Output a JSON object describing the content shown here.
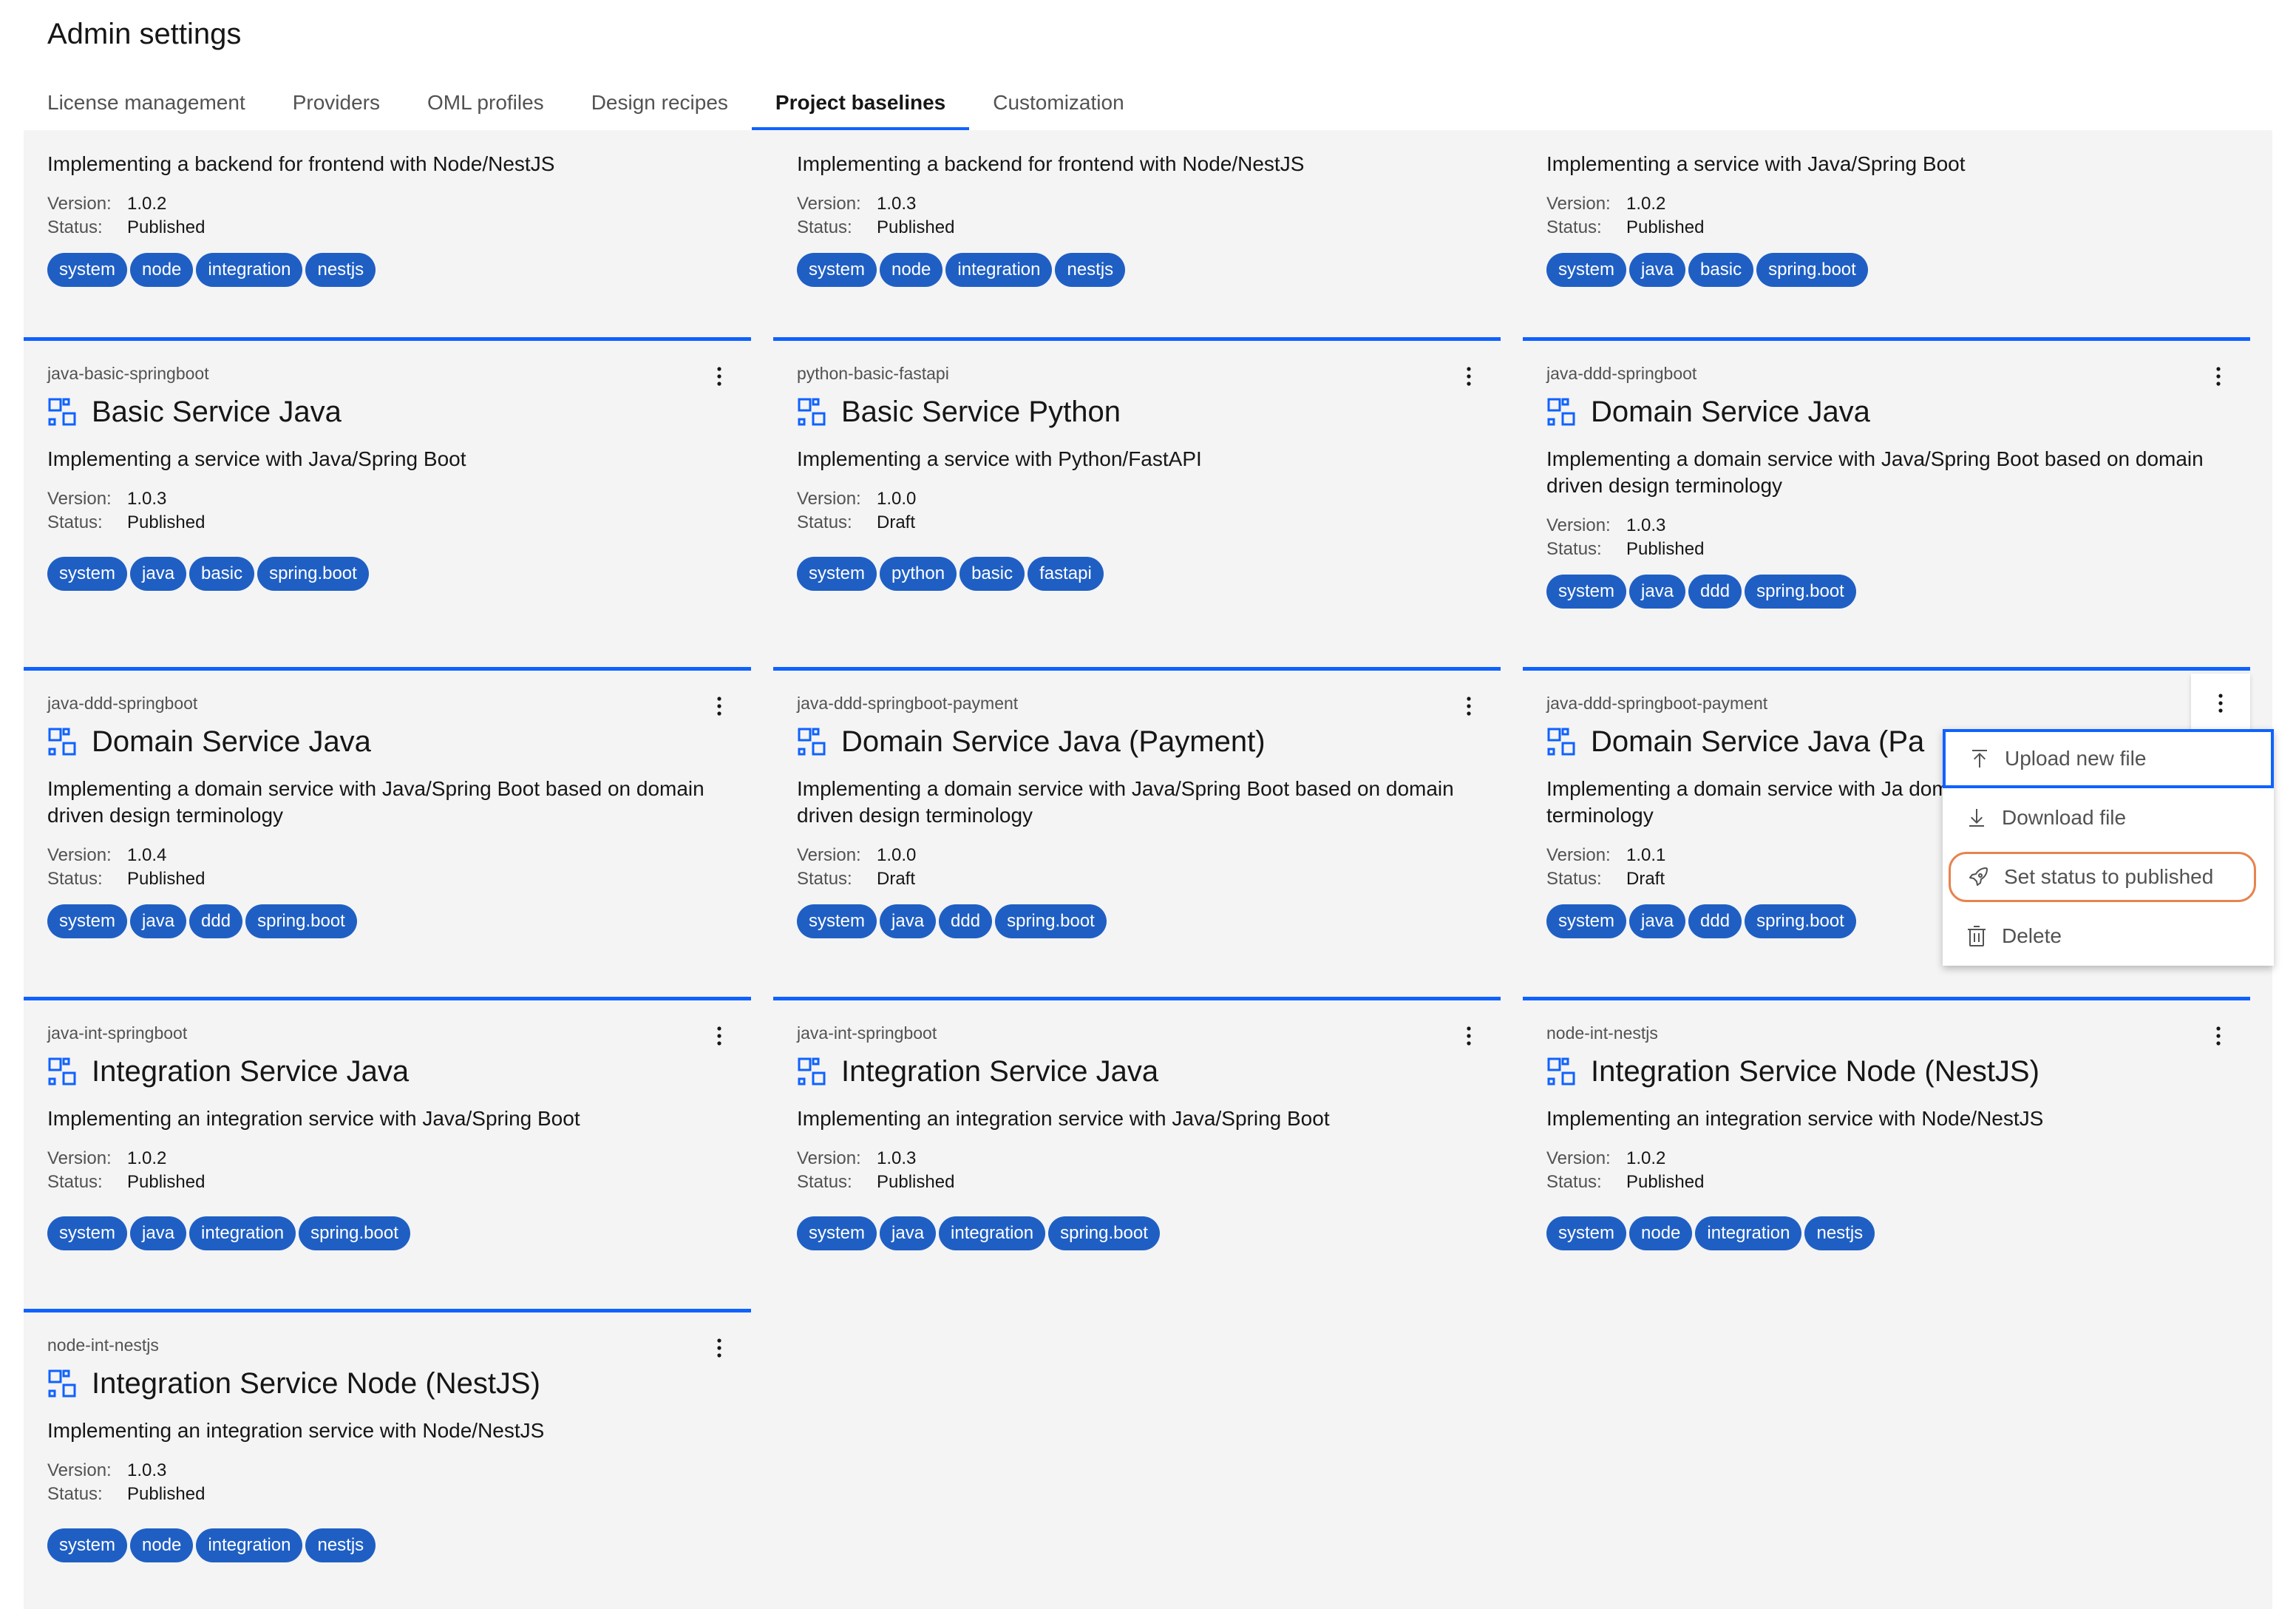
{
  "header": {
    "title": "Admin settings"
  },
  "tabs": [
    {
      "label": "License management",
      "active": false
    },
    {
      "label": "Providers",
      "active": false
    },
    {
      "label": "OML profiles",
      "active": false
    },
    {
      "label": "Design recipes",
      "active": false
    },
    {
      "label": "Project baselines",
      "active": true
    },
    {
      "label": "Customization",
      "active": false
    }
  ],
  "labels": {
    "version": "Version:",
    "status": "Status:"
  },
  "cards": [
    {
      "id": "",
      "title": "",
      "description": "Implementing a backend for frontend with Node/NestJS",
      "version": "1.0.2",
      "status": "Published",
      "tags": [
        "system",
        "node",
        "integration",
        "nestjs"
      ]
    },
    {
      "id": "",
      "title": "",
      "description": "Implementing a backend for frontend with Node/NestJS",
      "version": "1.0.3",
      "status": "Published",
      "tags": [
        "system",
        "node",
        "integration",
        "nestjs"
      ]
    },
    {
      "id": "",
      "title": "",
      "description": "Implementing a service with Java/Spring Boot",
      "version": "1.0.2",
      "status": "Published",
      "tags": [
        "system",
        "java",
        "basic",
        "spring.boot"
      ]
    },
    {
      "id": "java-basic-springboot",
      "title": "Basic Service Java",
      "description": "Implementing a service with Java/Spring Boot",
      "version": "1.0.3",
      "status": "Published",
      "tags": [
        "system",
        "java",
        "basic",
        "spring.boot"
      ]
    },
    {
      "id": "python-basic-fastapi",
      "title": "Basic Service Python",
      "description": "Implementing a service with Python/FastAPI",
      "version": "1.0.0",
      "status": "Draft",
      "tags": [
        "system",
        "python",
        "basic",
        "fastapi"
      ]
    },
    {
      "id": "java-ddd-springboot",
      "title": "Domain Service Java",
      "description": "Implementing a domain service with Java/Spring Boot based on domain driven design terminology",
      "version": "1.0.3",
      "status": "Published",
      "tags": [
        "system",
        "java",
        "ddd",
        "spring.boot"
      ]
    },
    {
      "id": "java-ddd-springboot",
      "title": "Domain Service Java",
      "description": "Implementing a domain service with Java/Spring Boot based on domain driven design terminology",
      "version": "1.0.4",
      "status": "Published",
      "tags": [
        "system",
        "java",
        "ddd",
        "spring.boot"
      ]
    },
    {
      "id": "java-ddd-springboot-payment",
      "title": "Domain Service Java (Payment)",
      "description": "Implementing a domain service with Java/Spring Boot based on domain driven design terminology",
      "version": "1.0.0",
      "status": "Draft",
      "tags": [
        "system",
        "java",
        "ddd",
        "spring.boot"
      ]
    },
    {
      "id": "java-ddd-springboot-payment",
      "title": "Domain Service Java (Pa",
      "description": "Implementing a domain service with Ja domain driven design terminology",
      "version": "1.0.1",
      "status": "Draft",
      "tags": [
        "system",
        "java",
        "ddd",
        "spring.boot"
      ]
    },
    {
      "id": "java-int-springboot",
      "title": "Integration Service Java",
      "description": "Implementing an integration service with Java/Spring Boot",
      "version": "1.0.2",
      "status": "Published",
      "tags": [
        "system",
        "java",
        "integration",
        "spring.boot"
      ]
    },
    {
      "id": "java-int-springboot",
      "title": "Integration Service Java",
      "description": "Implementing an integration service with Java/Spring Boot",
      "version": "1.0.3",
      "status": "Published",
      "tags": [
        "system",
        "java",
        "integration",
        "spring.boot"
      ]
    },
    {
      "id": "node-int-nestjs",
      "title": "Integration Service Node (NestJS)",
      "description": "Implementing an integration service with Node/NestJS",
      "version": "1.0.2",
      "status": "Published",
      "tags": [
        "system",
        "node",
        "integration",
        "nestjs"
      ]
    },
    {
      "id": "node-int-nestjs",
      "title": "Integration Service Node (NestJS)",
      "description": "Implementing an integration service with Node/NestJS",
      "version": "1.0.3",
      "status": "Published",
      "tags": [
        "system",
        "node",
        "integration",
        "nestjs"
      ]
    }
  ],
  "overflow_menu": {
    "items": [
      {
        "label": "Upload new file",
        "icon": "upload-icon"
      },
      {
        "label": "Download file",
        "icon": "download-icon"
      },
      {
        "label": "Set status to published",
        "icon": "rocket-icon"
      },
      {
        "label": "Delete",
        "icon": "trash-icon"
      }
    ]
  },
  "colors": {
    "accent": "#0f62fe",
    "tag_bg": "#1f5fc4",
    "highlight": "#e8834e",
    "surface": "#f4f4f4"
  }
}
